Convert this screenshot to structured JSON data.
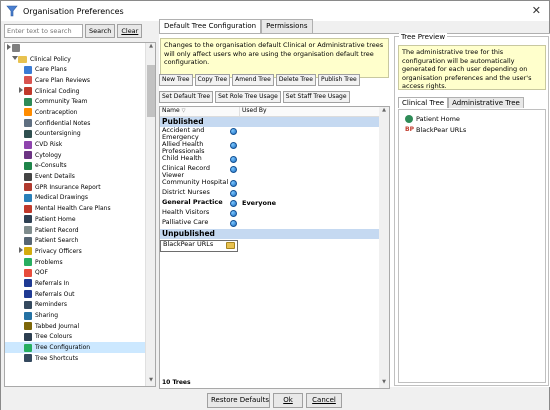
{
  "window": {
    "title": "Organisation Preferences",
    "close_glyph": "✕"
  },
  "search": {
    "placeholder": "Enter text to search",
    "search_label": "Search",
    "clear_label": "Clear"
  },
  "sidebar": {
    "items": [
      {
        "label": "",
        "level": 0,
        "icon": "box-icon",
        "color": "#7f7f7f",
        "expand": "collapsed"
      },
      {
        "label": "Clinical Policy",
        "level": 1,
        "icon": "folder-icon",
        "color": "#e8c250",
        "expand": "expanded"
      },
      {
        "label": "Care Plans",
        "level": 2,
        "icon": "care-plan-icon",
        "color": "#3a7bd5",
        "expand": "none"
      },
      {
        "label": "Care Plan Reviews",
        "level": 2,
        "icon": "care-plan-review-icon",
        "color": "#d9534f",
        "expand": "none"
      },
      {
        "label": "Clinical Coding",
        "level": 2,
        "icon": "r-icon",
        "color": "#c0392b",
        "expand": "collapsed"
      },
      {
        "label": "Community Team",
        "level": 2,
        "icon": "community-icon",
        "color": "#2e8b57",
        "expand": "none"
      },
      {
        "label": "Contraception",
        "level": 2,
        "icon": "contraception-icon",
        "color": "#ff8c00",
        "expand": "none"
      },
      {
        "label": "Confidential Notes",
        "level": 2,
        "icon": "notes-icon",
        "color": "#5f6f81",
        "expand": "none"
      },
      {
        "label": "Countersigning",
        "level": 2,
        "icon": "pen-icon",
        "color": "#2f4f4f",
        "expand": "none"
      },
      {
        "label": "CVD Risk",
        "level": 2,
        "icon": "heart-icon",
        "color": "#8e44ad",
        "expand": "none"
      },
      {
        "label": "Cytology",
        "level": 2,
        "icon": "cytology-icon",
        "color": "#6c3483",
        "expand": "none"
      },
      {
        "label": "e-Consults",
        "level": 2,
        "icon": "e-consult-icon",
        "color": "#1e8449",
        "expand": "none"
      },
      {
        "label": "Event Details",
        "level": 2,
        "icon": "event-icon",
        "color": "#444444",
        "expand": "none"
      },
      {
        "label": "GPR Insurance Report",
        "level": 2,
        "icon": "report-icon",
        "color": "#b03a2e",
        "expand": "none"
      },
      {
        "label": "Medical Drawings",
        "level": 2,
        "icon": "drawing-icon",
        "color": "#2980b9",
        "expand": "none"
      },
      {
        "label": "Mental Health Care Plans",
        "level": 2,
        "icon": "mental-health-icon",
        "color": "#c0392b",
        "expand": "none"
      },
      {
        "label": "Patient Home",
        "level": 2,
        "icon": "home-icon",
        "color": "#2e4053",
        "expand": "none"
      },
      {
        "label": "Patient Record",
        "level": 2,
        "icon": "record-icon",
        "color": "#7f8c8d",
        "expand": "none"
      },
      {
        "label": "Patient Search",
        "level": 2,
        "icon": "search-icon",
        "color": "#566573",
        "expand": "none"
      },
      {
        "label": "Privacy Officers",
        "level": 2,
        "icon": "privacy-icon",
        "color": "#d4ac0d",
        "expand": "collapsed"
      },
      {
        "label": "Problems",
        "level": 2,
        "icon": "problems-icon",
        "color": "#27ae60",
        "expand": "none"
      },
      {
        "label": "QOF",
        "level": 2,
        "icon": "qof-icon",
        "color": "#e74c3c",
        "expand": "none"
      },
      {
        "label": "Referrals In",
        "level": 2,
        "icon": "referral-in-icon",
        "color": "#1f3a93",
        "expand": "none"
      },
      {
        "label": "Referrals Out",
        "level": 2,
        "icon": "referral-out-icon",
        "color": "#1f3a93",
        "expand": "none"
      },
      {
        "label": "Reminders",
        "level": 2,
        "icon": "reminder-icon",
        "color": "#34495e",
        "expand": "none"
      },
      {
        "label": "Sharing",
        "level": 2,
        "icon": "sharing-icon",
        "color": "#2471a3",
        "expand": "none"
      },
      {
        "label": "Tabbed Journal",
        "level": 2,
        "icon": "journal-icon",
        "color": "#7d6608",
        "expand": "none"
      },
      {
        "label": "Tree Colours",
        "level": 2,
        "icon": "colours-icon",
        "color": "#2c3e50",
        "expand": "none"
      },
      {
        "label": "Tree Configuration",
        "level": 2,
        "icon": "tree-config-icon",
        "color": "#27ae60",
        "expand": "none",
        "selected": true
      },
      {
        "label": "Tree Shortcuts",
        "level": 2,
        "icon": "shortcut-icon",
        "color": "#34495e",
        "expand": "none"
      }
    ]
  },
  "tabs": [
    {
      "label": "Default Tree Configuration",
      "active": true
    },
    {
      "label": "Permissions",
      "active": false
    }
  ],
  "info": {
    "text": "Changes to the organisation default Clinical or Administrative trees will only affect users who are using the organisation default tree configuration."
  },
  "toolbar1": [
    "New Tree",
    "Copy Tree",
    "Amend Tree",
    "Delete Tree",
    "Publish Tree"
  ],
  "toolbar2": [
    "Set Default Tree",
    "Set Role Tree Usage",
    "Set Staff Tree Usage"
  ],
  "grid": {
    "col_name": "Name",
    "col_name_sort": "▽",
    "col_used": "Used By",
    "groups": [
      {
        "title": "Published",
        "rows": [
          {
            "name": "Accident and Emergency",
            "icon": "globe-icon",
            "used": ""
          },
          {
            "name": "Allied Health Professionals",
            "icon": "globe-icon",
            "used": ""
          },
          {
            "name": "Child Health",
            "icon": "globe-icon",
            "used": ""
          },
          {
            "name": "Clinical Record Viewer",
            "icon": "globe-icon",
            "used": ""
          },
          {
            "name": "Community Hospital",
            "icon": "globe-icon",
            "used": ""
          },
          {
            "name": "District Nurses",
            "icon": "globe-icon",
            "used": ""
          },
          {
            "name": "General Practice",
            "icon": "globe-icon",
            "used": "Everyone",
            "bold": true
          },
          {
            "name": "Health Visitors",
            "icon": "globe-icon",
            "used": ""
          },
          {
            "name": "Palliative Care",
            "icon": "globe-icon",
            "used": ""
          }
        ]
      },
      {
        "title": "Unpublished",
        "rows": [
          {
            "name": "BlackPear URLs",
            "icon": "folder-edit-icon",
            "used": "",
            "editing": true
          }
        ]
      }
    ],
    "footer": "10 Trees"
  },
  "preview": {
    "title": "Tree Preview",
    "info": "The administrative tree for this configuration will be automatically generated for each user depending on organisation preferences and the user's access rights.",
    "tabs": [
      {
        "label": "Clinical Tree",
        "active": true
      },
      {
        "label": "Administrative Tree",
        "active": false
      }
    ],
    "items": [
      {
        "label": "Patient Home",
        "icon": "patient-home-icon",
        "color": "#2e8b57"
      },
      {
        "label": "BlackPear URLs",
        "icon": "bp-icon",
        "color": "#c0392b"
      }
    ]
  },
  "footer": {
    "restore": "Restore Defaults",
    "ok": "Ok",
    "cancel": "Cancel"
  }
}
